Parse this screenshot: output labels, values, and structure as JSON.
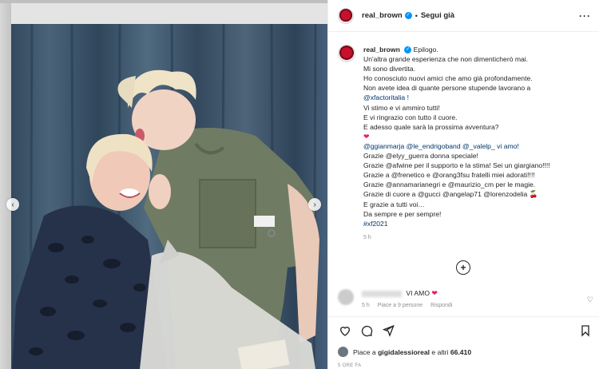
{
  "post": {
    "username": "real_brown",
    "follow_status": "Segui già",
    "more_icon": "more-horizontal-icon",
    "verified_icon": "verified-badge-icon"
  },
  "caption": {
    "username": "real_brown",
    "lines": [
      "Epilogo.",
      "Un'altra grande esperienza che non dimenticherò mai.",
      "Mi sono divertita.",
      "Ho conosciuto nuovi amici che amo già profondamente.",
      "Non avete idea di quante persone stupende lavorano a",
      "@xfactoritalia !",
      "Vi stimo e vi ammiro tutti!",
      "E vi ringrazio con tutto il cuore.",
      "E adesso quale sarà la prossima avventura?",
      "❤",
      "@ggianmarja @le_endrigoband @_valelp_ vi amo!",
      "Grazie @elyy_guerra donna speciale!",
      "Grazie @afwine per il supporto e la stima! Sei un giargiano!!!!",
      "Grazie a @frenetico e @orang3fsu fratelli miei adorati!!!!",
      "Grazie @annamarianegri e @maurizio_cm per le magie.",
      "Grazie di cuore a @gucci @angelap71 @lorenzodelia 🍒",
      "E grazie a tutti voi…",
      "Da sempre e per sempre!",
      "#xf2021"
    ],
    "time": "5 h"
  },
  "comment": {
    "text": "VI AMO",
    "emoji": "❤",
    "time": "5 h",
    "likes": "Piace a 9 persone",
    "reply": "Rispondi"
  },
  "actions": {
    "icons": [
      "heart-icon",
      "comment-icon",
      "share-icon",
      "bookmark-icon"
    ]
  },
  "likes": {
    "prefix": "Piace a",
    "user": "gigidalessioreal",
    "suffix": "e altri",
    "count": "66.410"
  },
  "date": "5 ORE FA",
  "colors": {
    "link": "#00376b",
    "verified": "#0095f6",
    "muted": "#8e8e8e",
    "background_photo": "#3d5266"
  }
}
